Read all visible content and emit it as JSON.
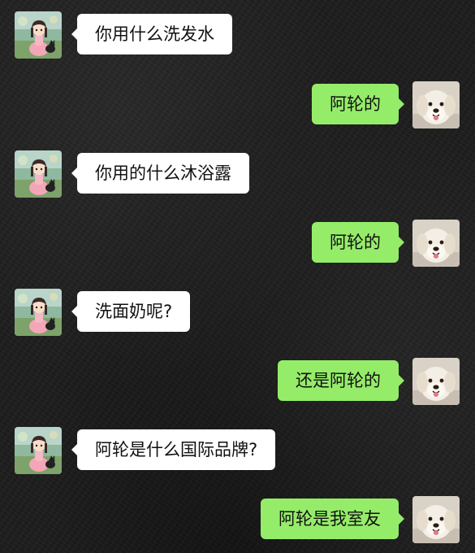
{
  "chat": {
    "messages": [
      {
        "sender": "friend",
        "avatar": "girl-with-cat-avatar",
        "text": "你用什么洗发水"
      },
      {
        "sender": "me",
        "avatar": "white-dog-avatar",
        "text": "阿轮的"
      },
      {
        "sender": "friend",
        "avatar": "girl-with-cat-avatar",
        "text": "你用的什么沐浴露"
      },
      {
        "sender": "me",
        "avatar": "white-dog-avatar",
        "text": "阿轮的"
      },
      {
        "sender": "friend",
        "avatar": "girl-with-cat-avatar",
        "text": "洗面奶呢?"
      },
      {
        "sender": "me",
        "avatar": "white-dog-avatar",
        "text": "还是阿轮的"
      },
      {
        "sender": "friend",
        "avatar": "girl-with-cat-avatar",
        "text": "阿轮是什么国际品牌?"
      },
      {
        "sender": "me",
        "avatar": "white-dog-avatar",
        "text": "阿轮是我室友"
      }
    ]
  },
  "colors": {
    "background": "#1d1d1d",
    "incoming_bubble": "#ffffff",
    "outgoing_bubble": "#95ec69",
    "text": "#111111"
  }
}
